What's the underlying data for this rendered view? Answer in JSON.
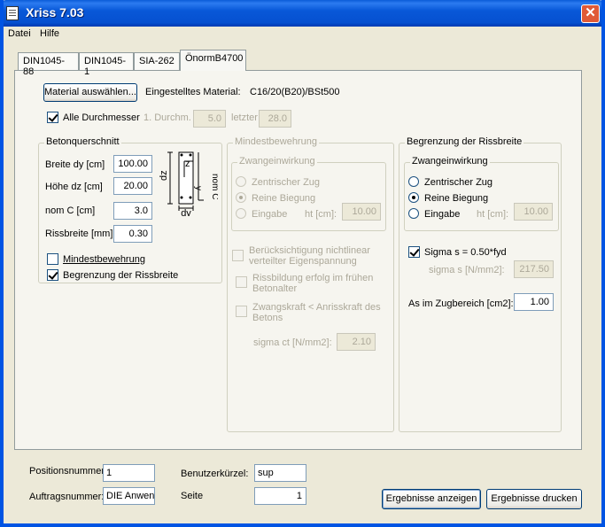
{
  "window": {
    "title": "Xriss 7.03",
    "close": "✕"
  },
  "menu": {
    "datei": "Datei",
    "hilfe": "Hilfe"
  },
  "tabs": [
    "DIN1045-88",
    "DIN1045-1",
    "SIA-262",
    "ÖnormB4700"
  ],
  "material": {
    "button": "Material auswählen...",
    "label": "Eingestelltes Material:",
    "value": "C16/20(B20)/BSt500"
  },
  "durchmesser": {
    "alle_label": "Alle Durchmesser",
    "erster_label": "1. Durchm.",
    "erster_value": "5.0",
    "letzter_label": "letzter",
    "letzter_value": "28.0"
  },
  "betonquerschnitt": {
    "title": "Betonquerschnitt",
    "breite_label": "Breite dy [cm]",
    "breite_value": "100.00",
    "hoehe_label": "Höhe dz [cm]",
    "hoehe_value": "20.00",
    "nomc_label": "nom C [cm]",
    "nomc_value": "3.0",
    "riss_label": "Rissbreite [mm]",
    "riss_value": "0.30",
    "mindest_label": "Mindestbewehrung",
    "begrenzung_label": "Begrenzung der Rissbreite",
    "diagram": {
      "dz": "dz",
      "dy": "dy",
      "z": "z",
      "y": "y",
      "nomc": "nom C"
    }
  },
  "mindestbewehrung": {
    "title": "Mindestbewehrung",
    "sub": "Zwangeinwirkung",
    "zentrisch": "Zentrischer Zug",
    "biegung": "Reine Biegung",
    "eingabe": "Eingabe",
    "ht_label": "ht [cm]:",
    "ht_value": "10.00",
    "nichtlinear": "Berücksichtigung nichtlinear verteilter Eigenspannung",
    "frueh": "Rissbildung erfolg im frühen Betonalter",
    "zwangskraft": "Zwangskraft < Anrisskraft des Betons",
    "sigma_ct_label": "sigma ct [N/mm2]:",
    "sigma_ct_value": "2.10"
  },
  "begrenzung": {
    "title": "Begrenzung der Rissbreite",
    "sub": "Zwangeinwirkung",
    "zentrisch": "Zentrischer Zug",
    "biegung": "Reine Biegung",
    "eingabe": "Eingabe",
    "ht_label": "ht [cm]:",
    "ht_value": "10.00",
    "sigma_label": "Sigma s = 0.50*fyd",
    "sigma_s_label": "sigma s [N/mm2]:",
    "sigma_s_value": "217.50",
    "as_label": "As im Zugbereich [cm2]:",
    "as_value": "1.00"
  },
  "footer": {
    "positionsnummer_label": "Positionsnummer:",
    "positionsnummer_value": "1",
    "auftragsnummer_label": "Auftragsnummer:",
    "auftragsnummer_value": "DIE Anwen",
    "benutzer_label": "Benutzerkürzel:",
    "benutzer_value": "sup",
    "seite_label": "Seite",
    "seite_value": "1",
    "anzeigen": "Ergebnisse anzeigen",
    "drucken": "Ergebnisse drucken"
  }
}
